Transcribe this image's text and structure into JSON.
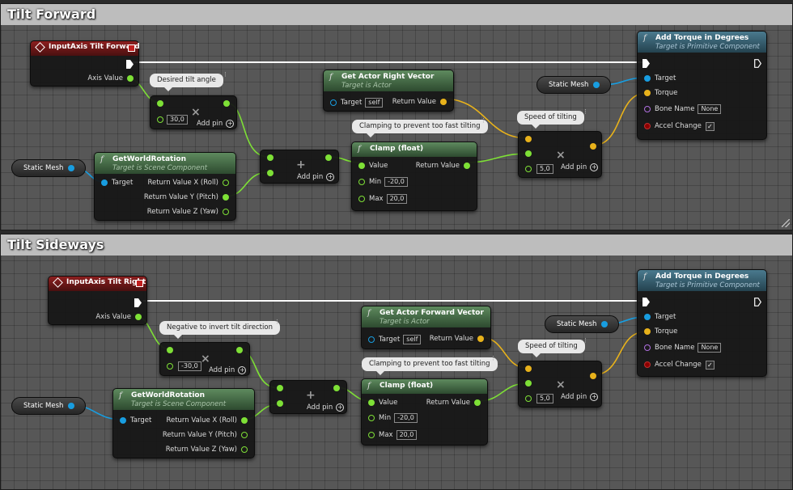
{
  "comments": [
    {
      "title": "Tilt Forward"
    },
    {
      "title": "Tilt Sideways"
    }
  ],
  "common": {
    "add_pin": "Add pin",
    "target": "Target",
    "torque": "Torque",
    "bone_name": "Bone Name",
    "none": "None",
    "accel_change": "Accel Change",
    "check": "✓",
    "static_mesh": "Static Mesh",
    "axis_value": "Axis Value",
    "self": "self",
    "return_value": "Return Value",
    "value": "Value",
    "min": "Min",
    "max": "Max",
    "clamp_bubble": "Clamping to prevent too fast tilting",
    "speed_bubble": "Speed of tilting",
    "get_world_rotation": "GetWorldRotation",
    "target_is_scene": "Target is Scene Component",
    "ret_x": "Return Value X (Roll)",
    "ret_y": "Return Value Y (Pitch)",
    "ret_z": "Return Value Z (Yaw)",
    "add_torque": "Add Torque in Degrees",
    "target_is_primitive": "Target is Primitive Component",
    "target_is_actor": "Target is Actor",
    "clamp_title": "Clamp (float)",
    "min_val": "-20,0",
    "max_val": "20,0",
    "speed_val": "5,0"
  },
  "forward": {
    "event_title": "InputAxis Tilt Forward",
    "bubble_angle": "Desired tilt angle",
    "angle_val": "30,0",
    "vector_title": "Get Actor Right Vector"
  },
  "sideways": {
    "event_title": "InputAxis Tilt Right",
    "bubble_angle": "Negative to invert tilt direction",
    "angle_val": "-30,0",
    "vector_title": "Get Actor Forward Vector"
  },
  "colors": {
    "exec": "#ffffff",
    "float": "#7ee036",
    "vector": "#e8b21b",
    "object": "#189de0"
  }
}
